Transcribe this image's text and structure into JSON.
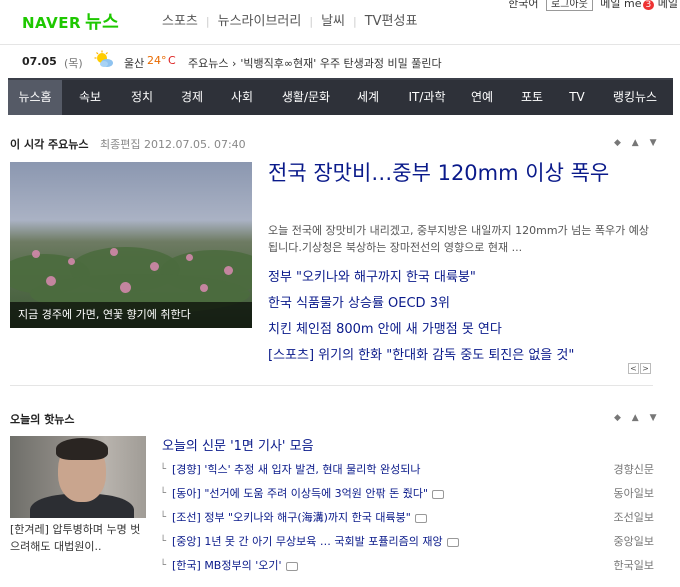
{
  "header": {
    "logo": "NAVER",
    "service": "뉴스",
    "nav": [
      "스포츠",
      "뉴스라이브러리",
      "날씨",
      "TV편성표"
    ],
    "right_links": [
      "한국어",
      "로그아웃",
      "메일",
      "me",
      "메일"
    ],
    "me_badge": "3"
  },
  "infobar": {
    "date": "07.05",
    "day": "(목)",
    "weather_icon": "partly-sunny-icon",
    "city": "울산",
    "temp": "24°",
    "unit": "C",
    "ticker_label": "주요뉴스 ›",
    "ticker_text": "'빅뱅직후∞현재' 우주 탄생과정 비밀 풀린다"
  },
  "mainnav": {
    "tabs": [
      "뉴스홈",
      "속보",
      "정치",
      "경제",
      "사회",
      "생활/문화",
      "세계",
      "IT/과학",
      "연예",
      "포토",
      "TV",
      "랭킹뉴스"
    ]
  },
  "top_news": {
    "title": "이 시각 주요뉴스",
    "meta": "최종편집 2012.07.05. 07:40",
    "photo_caption": "지금 경주에 가면, 연꽃 향기에 취한다",
    "headline": "전국 장맛비…중부 120mm 이상 폭우",
    "summary": "오늘 전국에 장맛비가 내리겠고, 중부지방은 내일까지 120mm가 넘는 폭우가 예상됩니다.기상청은 북상하는 장마전선의 영향으로 현재 ...",
    "items": [
      "정부 \"오키나와 해구까지 한국 대륙붕\"",
      "한국 식품물가 상승률 OECD 3위",
      "치킨 체인점 800m 안에 새 가맹점 못 연다",
      "[스포츠] 위기의 한화 \"한대화 감독 중도 퇴진은 없을 것\""
    ],
    "pager": [
      "<",
      ">"
    ]
  },
  "hot_news": {
    "title": "오늘의 핫뉴스",
    "photo_caption": "[한겨레] 압투병하며 누명 벗으려해도 대법원이..",
    "list_title": "오늘의 신문 '1면 기사' 모음",
    "rows": [
      {
        "text": "[경향] '힉스' 추정 새 입자 발견, 현대 물리학 완성되나",
        "source": "경향신문",
        "camera": false
      },
      {
        "text": "[동아] \"선거에 도움 주려 이상득에 3억원 안팎 돈 줬다\"",
        "source": "동아일보",
        "camera": true
      },
      {
        "text": "[조선] 정부 \"오키나와 해구(海溝)까지 한국 대륙붕\"",
        "source": "조선일보",
        "camera": true
      },
      {
        "text": "[중앙] 1년 못 간 아기 무상보육 … 국회발 포퓰리즘의 재앙",
        "source": "중앙일보",
        "camera": true
      },
      {
        "text": "[한국] MB정부의 '오기'",
        "source": "한국일보",
        "camera": true
      }
    ]
  },
  "controls": "◆ ▲ ▼"
}
